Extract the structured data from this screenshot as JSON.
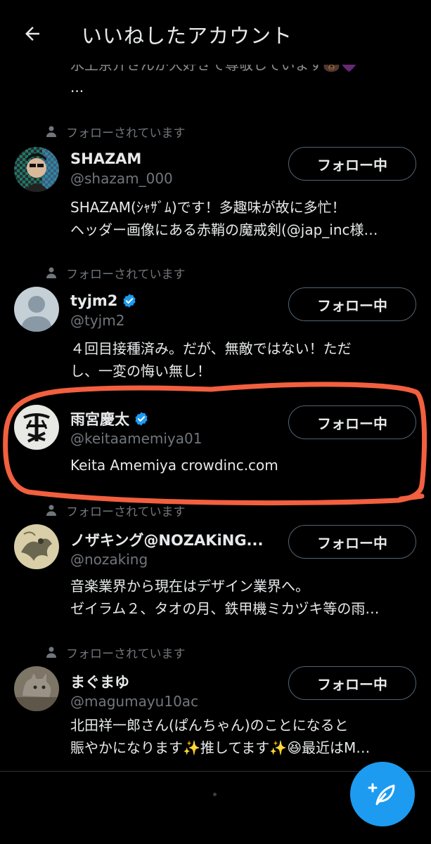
{
  "header": {
    "title": "いいねしたアカウント"
  },
  "partial_bio": {
    "line1": "水上京介さんが大好きで尊敬しています🐻💜",
    "line2": "..."
  },
  "follow_button_label": "フォロー中",
  "users": [
    {
      "follows_you": "フォローされています",
      "name": "SHAZAM",
      "verified": false,
      "handle": "@shazam_000",
      "bio": [
        "SHAZAM(ｼｬｻﾞﾑ)です！多趣味が故に多忙！",
        "ヘッダー画像にある赤鞘の魔戒剣(@jap_inc様…"
      ]
    },
    {
      "follows_you": "フォローされています",
      "name": "tyjm2",
      "verified": true,
      "handle": "@tyjm2",
      "bio": [
        "４回目接種済み。だが、無敵ではない！ただ",
        "し、一変の悔い無し！"
      ]
    },
    {
      "follows_you": "",
      "name": "雨宮慶太",
      "verified": true,
      "handle": "@keitaamemiya01",
      "bio": [
        "Keita Amemiya crowdinc.com"
      ]
    },
    {
      "follows_you": "フォローされています",
      "name": "ノザキング@NOZAKiNG...",
      "verified": false,
      "handle": "@nozaking",
      "bio": [
        "音楽業界から現在はデザイン業界へ。",
        "ゼイラム２、タオの月、鉄甲機ミカヅキ等の雨…"
      ]
    },
    {
      "follows_you": "フォローされています",
      "name": "まぐまゆ",
      "verified": false,
      "handle": "@magumayu10ac",
      "bio": [
        "北田祥一郎さん(ぱんちゃん)のことになると",
        "賑やかになります✨推してます✨😆最近はM…"
      ]
    }
  ],
  "colors": {
    "background": "#000000",
    "text_primary": "#e7e9ea",
    "text_secondary": "#71767b",
    "accent": "#1d9bf0",
    "highlight_stroke": "#f2603f"
  },
  "icons": {
    "back": "arrow-left-icon",
    "follows": "person-icon",
    "verified": "verified-badge-icon",
    "compose": "compose-tweet-icon"
  }
}
